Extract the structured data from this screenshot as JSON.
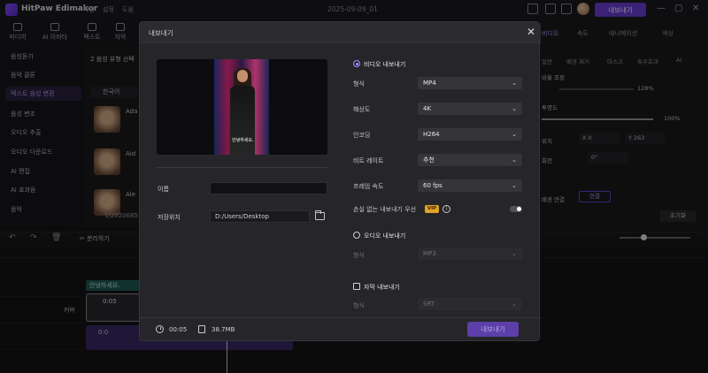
{
  "titlebar": {
    "app_name": "HitPaw Edimakor",
    "menus": [
      "파일",
      "설정",
      "도움"
    ],
    "project_name": "2025-09-09_01",
    "export_button": "내보내기"
  },
  "left_tabs": [
    "미디어",
    "AI 아바타",
    "텍스트",
    "자막"
  ],
  "left_panel": {
    "items": [
      "음성듣기",
      "음악 클론",
      "텍스트 음성 변환",
      "음성 변조",
      "오디오 추출",
      "오디오 다운로드",
      "AI 편집",
      "AI 효과음",
      "음악"
    ],
    "active_index": 2,
    "step_label": "음성 유형 선택",
    "language": "한국어",
    "entries": [
      "Ada",
      "Aid",
      "Ale"
    ],
    "item_footer": "1/2020685"
  },
  "right_panel": {
    "tabs": [
      "비디오",
      "속도",
      "애니메이션",
      "색상"
    ],
    "subtabs": [
      "일반",
      "배경 제거",
      "마스크",
      "특수효과",
      "AI"
    ],
    "rows": [
      "비율 조정",
      "투명도",
      "위치",
      "회전",
      "배경 연결"
    ],
    "values": [
      "128%",
      "100%",
      "X 0",
      "Y 263",
      "0°"
    ],
    "link_button": "연결",
    "reset_button": "초기화"
  },
  "timeline": {
    "split_label": "분리하기",
    "text_clip": "안녕하세요.",
    "video_clip_time": "0:05",
    "audio_clip_time": "0:0",
    "track_label": "커버"
  },
  "modal": {
    "title": "내보내기",
    "preview_caption": "안녕하세요.",
    "name_label": "이름",
    "name_value": "",
    "path_label": "저장위치",
    "path_value": "D:/Users/Desktop",
    "video_section": "비디오 내보내기",
    "rows": [
      {
        "label": "형식",
        "value": "MP4"
      },
      {
        "label": "해상도",
        "value": "4K"
      },
      {
        "label": "인코딩",
        "value": "H264"
      },
      {
        "label": "비트 레이트",
        "value": "추천"
      },
      {
        "label": "프레임 속도",
        "value": "60  fps"
      }
    ],
    "lossless_label": "손실 없는 내보내기 우선",
    "vip_badge": "VIP",
    "audio_section": "오디오 내보내기",
    "audio_format_label": "형식",
    "audio_format_value": "MP3",
    "subtitle_section": "자막 내보내기",
    "subtitle_format_label": "형식",
    "subtitle_format_value": "SRT",
    "duration": "00:05",
    "size": "38.7MB",
    "export_button": "내보내기"
  },
  "colors": {
    "accent": "#6c3fd8",
    "radio_accent": "#a88bff",
    "vip": "#e0a22a"
  }
}
